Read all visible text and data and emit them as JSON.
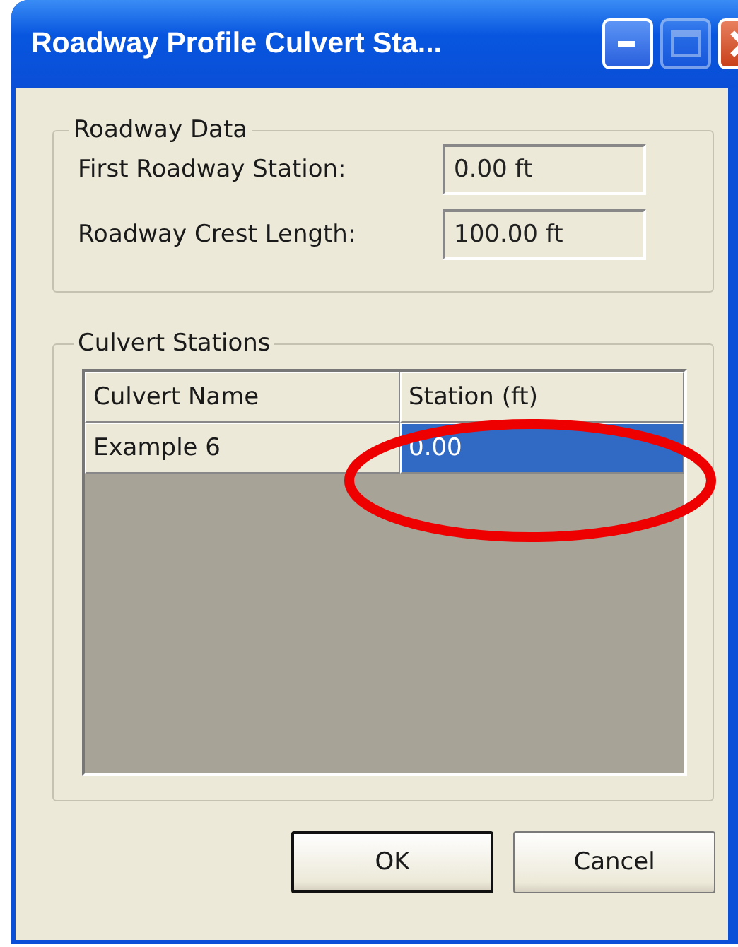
{
  "window": {
    "title": "Roadway Profile Culvert Sta..."
  },
  "title_buttons": [
    {
      "kind": "minimize",
      "disabled": false
    },
    {
      "kind": "maximize",
      "disabled": true
    },
    {
      "kind": "close",
      "disabled": false
    }
  ],
  "roadway_data": {
    "title": "Roadway Data",
    "fields": [
      {
        "label": "First Roadway Station:",
        "value": "0.00 ft"
      },
      {
        "label": "Roadway Crest Length:",
        "value": "100.00 ft"
      }
    ]
  },
  "culvert_stations": {
    "title": "Culvert Stations",
    "columns": [
      "Culvert Name",
      "Station (ft)"
    ],
    "rows": [
      {
        "cells": [
          {
            "text": "Example 6",
            "selected": false
          },
          {
            "text": "0.00",
            "selected": true
          }
        ]
      }
    ]
  },
  "annotation": {
    "kind": "ellipse"
  },
  "buttons": [
    {
      "label": "OK",
      "default": true
    },
    {
      "label": "Cancel",
      "default": false
    }
  ]
}
